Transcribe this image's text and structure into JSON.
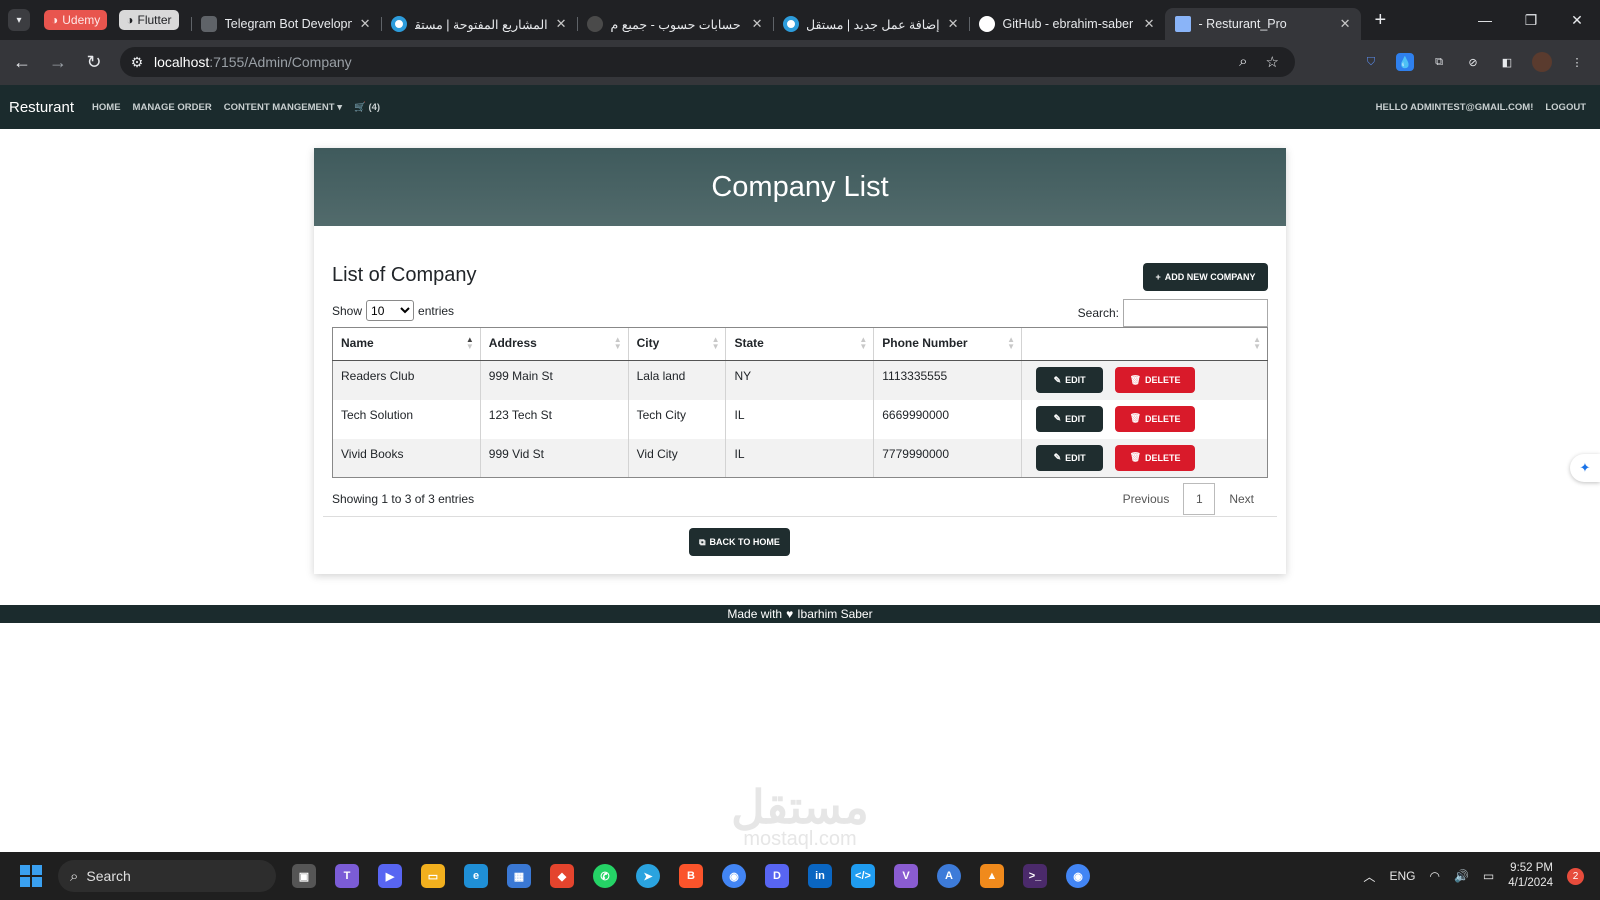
{
  "browser": {
    "chips": [
      {
        "label": "Udemy",
        "icon": "udemy-icon"
      },
      {
        "label": "Flutter",
        "icon": "flutter-icon"
      }
    ],
    "tabs": [
      {
        "title": "Telegram Bot Developm",
        "icon": "telegram-icon"
      },
      {
        "title": "المشاريع المفتوحة | مستقل",
        "icon": "mostaql-icon"
      },
      {
        "title": "حسابات حسوب - جميع م",
        "icon": "hsoub-icon"
      },
      {
        "title": "إضافة عمل جديد | مستقل",
        "icon": "mostaql-icon"
      },
      {
        "title": "GitHub - ebrahim-saber",
        "icon": "github-icon"
      },
      {
        "title": "- Resturant_Pro",
        "icon": "page-icon",
        "active": true
      }
    ],
    "url": {
      "host": "localhost",
      "path": ":7155/Admin/Company"
    }
  },
  "nav": {
    "brand": "Resturant",
    "home": "HOME",
    "manage_order": "MANAGE ORDER",
    "content": "CONTENT MANGEMENT",
    "cart_count": "(4)",
    "hello": "HELLO ADMINTEST@GMAIL.COM!",
    "logout": "LOGOUT"
  },
  "card": {
    "title": "Company List",
    "subtitle": "List of Company",
    "add_button": "ADD NEW COMPANY",
    "show_label": "Show",
    "page_size": "10",
    "entries_label": "entries",
    "search_label": "Search:",
    "columns": [
      "Name",
      "Address",
      "City",
      "State",
      "Phone Number",
      ""
    ],
    "rows": [
      {
        "name": "Readers Club",
        "address": "999 Main St",
        "city": "Lala land",
        "state": "NY",
        "phone": "1113335555"
      },
      {
        "name": "Tech Solution",
        "address": "123 Tech St",
        "city": "Tech City",
        "state": "IL",
        "phone": "6669990000"
      },
      {
        "name": "Vivid Books",
        "address": "999 Vid St",
        "city": "Vid City",
        "state": "IL",
        "phone": "7779990000"
      }
    ],
    "edit_label": "EDIT",
    "delete_label": "DELETE",
    "info": "Showing 1 to 3 of 3 entries",
    "previous": "Previous",
    "current_page": "1",
    "next": "Next",
    "back_button": "BACK TO HOME"
  },
  "footer": {
    "made_with": "Made with",
    "author": "Ibarhim Saber"
  },
  "watermark": {
    "ar": "مستقل",
    "en": "mostaql.com"
  },
  "taskbar": {
    "search": "Search",
    "lang": "ENG",
    "time": "9:52 PM",
    "date": "4/1/2024",
    "notifications": "2"
  },
  "colors": {
    "navbar": "#1b2b2d",
    "header_gradient": "#4a6466",
    "danger": "#d91a2a",
    "dark_button": "#1f2d2f"
  }
}
